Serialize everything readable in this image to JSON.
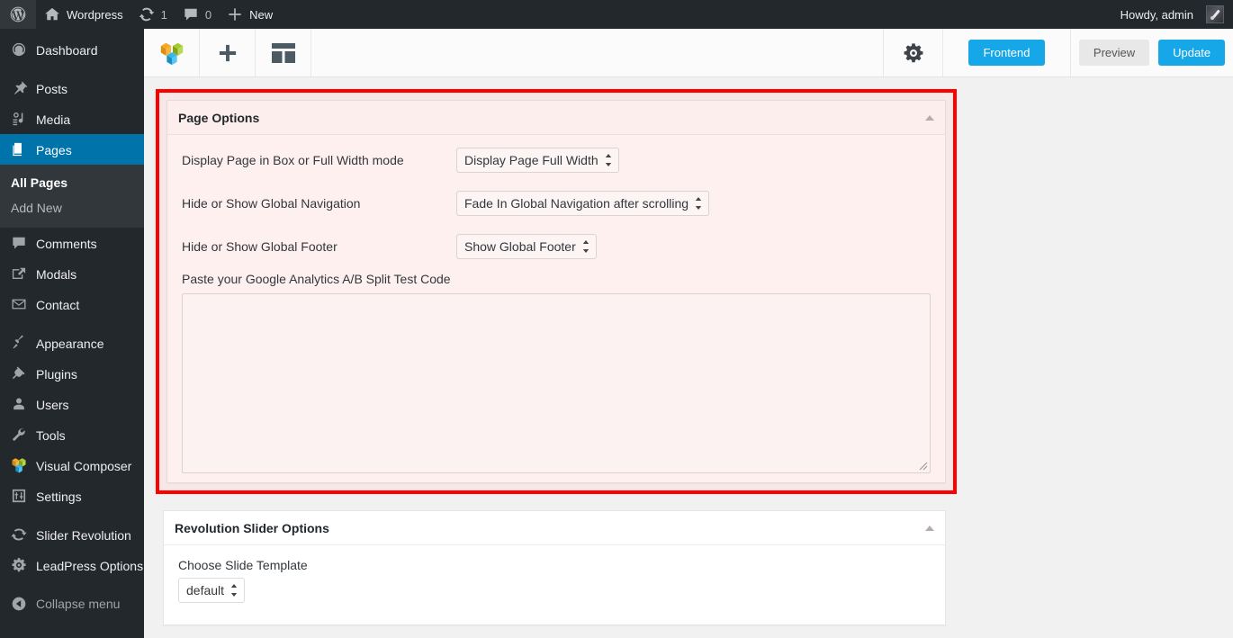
{
  "adminbar": {
    "wp_logo_icon": "wordpress-logo-icon",
    "site_icon": "home-icon",
    "site_name": "Wordpress",
    "updates_icon": "updates-icon",
    "updates_count": "1",
    "comments_icon": "comment-bubble-icon",
    "comments_count": "0",
    "new_icon": "plus-icon",
    "new_label": "New",
    "howdy": "Howdy, admin",
    "avatar_icon": "avatar-icon"
  },
  "sidebar": {
    "items": [
      {
        "label": "Dashboard",
        "icon": "dashboard-icon",
        "active": false
      },
      {
        "label": "Posts",
        "icon": "pin-icon",
        "active": false
      },
      {
        "label": "Media",
        "icon": "media-icon",
        "active": false
      },
      {
        "label": "Pages",
        "icon": "pages-icon",
        "active": true
      },
      {
        "label": "Comments",
        "icon": "comment-bubble-icon",
        "active": false
      },
      {
        "label": "Modals",
        "icon": "modals-icon",
        "active": false
      },
      {
        "label": "Contact",
        "icon": "envelope-icon",
        "active": false
      },
      {
        "label": "Appearance",
        "icon": "paintbrush-icon",
        "active": false
      },
      {
        "label": "Plugins",
        "icon": "plug-icon",
        "active": false
      },
      {
        "label": "Users",
        "icon": "user-icon",
        "active": false
      },
      {
        "label": "Tools",
        "icon": "wrench-icon",
        "active": false
      },
      {
        "label": "Visual Composer",
        "icon": "visual-composer-icon",
        "active": false
      },
      {
        "label": "Settings",
        "icon": "sliders-icon",
        "active": false
      },
      {
        "label": "Slider Revolution",
        "icon": "slider-revolution-icon",
        "active": false
      },
      {
        "label": "LeadPress Options",
        "icon": "gear-icon",
        "active": false
      }
    ],
    "submenu": [
      {
        "label": "All Pages",
        "current": true
      },
      {
        "label": "Add New",
        "current": false
      }
    ],
    "collapse": {
      "label": "Collapse menu",
      "icon": "collapse-arrow-icon"
    }
  },
  "toolbar": {
    "logo_icon": "visual-composer-logo-icon",
    "add_icon": "plus-icon",
    "templates_icon": "templates-layout-icon",
    "settings_icon": "gear-icon",
    "frontend_label": "Frontend",
    "preview_label": "Preview",
    "update_label": "Update"
  },
  "page_options": {
    "title": "Page Options",
    "toggle_icon": "collapse-triangle-icon",
    "fields": [
      {
        "label": "Display Page in Box or Full Width mode",
        "value": "Display Page Full Width",
        "name": "display-page-width-select"
      },
      {
        "label": "Hide or Show Global Navigation",
        "value": "Fade In Global Navigation after scrolling",
        "name": "global-navigation-select"
      },
      {
        "label": "Hide or Show Global Footer",
        "value": "Show Global Footer",
        "name": "global-footer-select"
      }
    ],
    "textarea_label": "Paste your Google Analytics A/B Split Test Code",
    "textarea_value": "",
    "textarea_placeholder": ""
  },
  "revolution_slider": {
    "title": "Revolution Slider Options",
    "toggle_icon": "collapse-triangle-icon",
    "field_label": "Choose Slide Template",
    "field_value": "default"
  },
  "colors": {
    "admin_dark": "#23282d",
    "admin_blue": "#0073aa",
    "accent_blue": "#16a7e8",
    "highlight_red": "#fe0000",
    "panel_pink": "#fff0f0"
  }
}
